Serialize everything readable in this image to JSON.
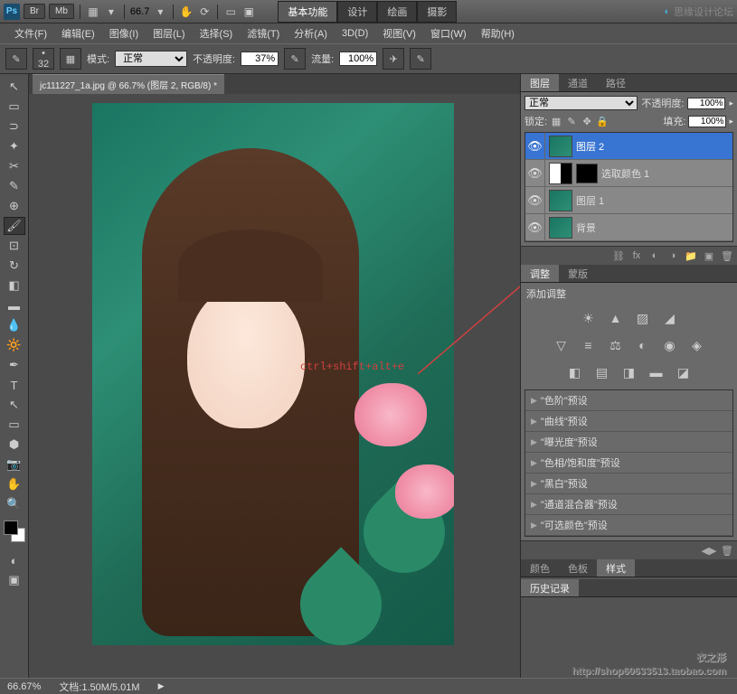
{
  "titlebar": {
    "ps": "Ps",
    "br": "Br",
    "mb": "Mb",
    "zoom": "66.7"
  },
  "workspace": {
    "tabs": [
      "基本功能",
      "设计",
      "绘画",
      "摄影"
    ]
  },
  "watermark_top": "思缘设计论坛",
  "menubar": [
    "文件(F)",
    "编辑(E)",
    "图像(I)",
    "图层(L)",
    "选择(S)",
    "滤镜(T)",
    "分析(A)",
    "3D(D)",
    "视图(V)",
    "窗口(W)",
    "帮助(H)"
  ],
  "optbar": {
    "brush_size": "32",
    "mode_label": "模式:",
    "mode_value": "正常",
    "opacity_label": "不透明度:",
    "opacity_value": "37%",
    "flow_label": "流量:",
    "flow_value": "100%"
  },
  "document": {
    "tab": "jc111227_1a.jpg @ 66.7% (图层 2, RGB/8) *"
  },
  "annotation": "ctrl+shift+alt+e",
  "layers_panel": {
    "tabs": [
      "图层",
      "通道",
      "路径"
    ],
    "blend": "正常",
    "opacity_label": "不透明度:",
    "opacity": "100%",
    "lock_label": "锁定:",
    "fill_label": "填充:",
    "fill": "100%",
    "layers": [
      {
        "name": "图层 2",
        "selected": true,
        "thumb": "img"
      },
      {
        "name": "选取颜色 1",
        "selected": false,
        "thumb": "adj"
      },
      {
        "name": "图层 1",
        "selected": false,
        "thumb": "img"
      },
      {
        "name": "背景",
        "selected": false,
        "thumb": "img"
      }
    ]
  },
  "adjustments": {
    "tabs": [
      "调整",
      "蒙版"
    ],
    "title": "添加调整"
  },
  "presets": [
    "\"色阶\"预设",
    "\"曲线\"预设",
    "\"曝光度\"预设",
    "\"色相/饱和度\"预设",
    "\"黑白\"预设",
    "\"通道混合器\"预设",
    "\"可选颜色\"预设"
  ],
  "bottom_tabs": [
    "颜色",
    "色板",
    "样式"
  ],
  "history_tab": "历史记录",
  "statusbar": {
    "zoom": "66.67%",
    "doc": "文档:1.50M/5.01M"
  },
  "watermark_shop": {
    "line1": "衣之形",
    "line2": "http://shop60633513.taobao.com"
  }
}
